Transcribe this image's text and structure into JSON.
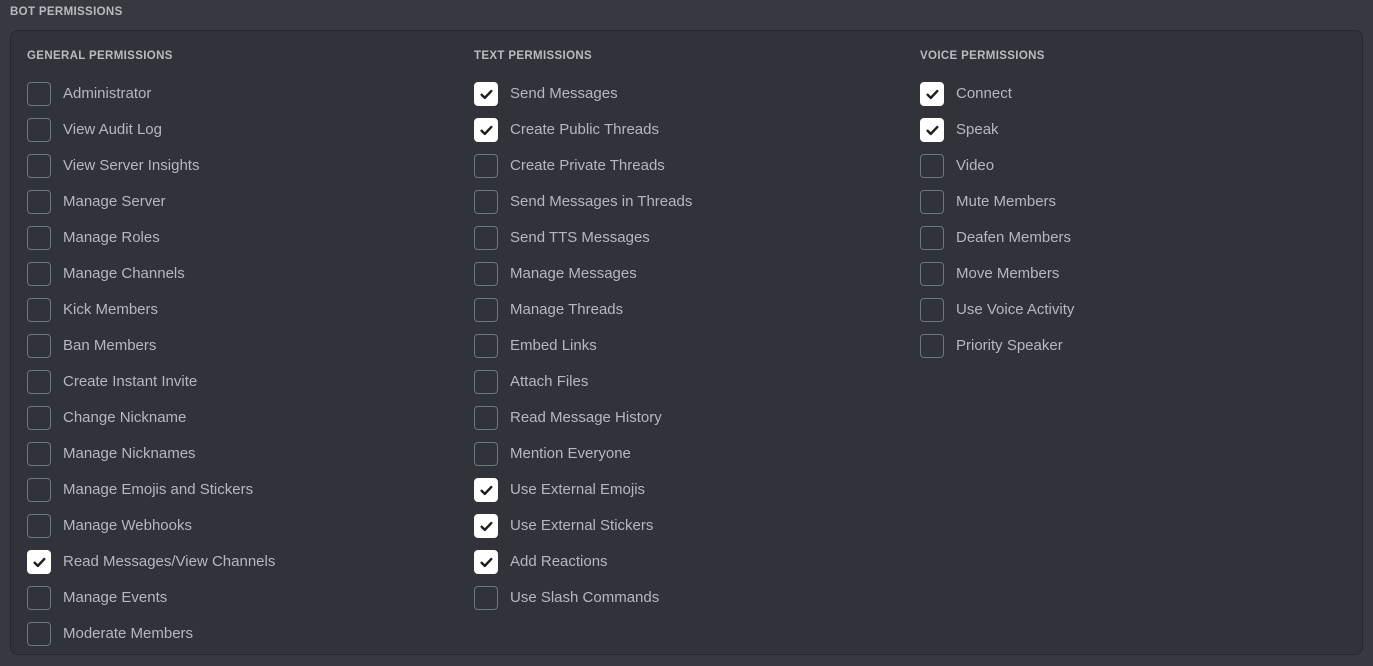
{
  "page": {
    "heading": "BOT PERMISSIONS",
    "background_color": "#36393f",
    "panel_color": "#303339",
    "panel_border_color": "#26282c",
    "label_color": "#b5b8bd",
    "heading_color": "#b9bbbe",
    "checkbox_checked_color": "#ffffff",
    "checkbox_unchecked_border_color": "#72767d",
    "checkmark_color": "#1e1f22"
  },
  "columns": [
    {
      "title": "GENERAL PERMISSIONS",
      "items": [
        {
          "label": "Administrator",
          "checked": false
        },
        {
          "label": "View Audit Log",
          "checked": false
        },
        {
          "label": "View Server Insights",
          "checked": false
        },
        {
          "label": "Manage Server",
          "checked": false
        },
        {
          "label": "Manage Roles",
          "checked": false
        },
        {
          "label": "Manage Channels",
          "checked": false
        },
        {
          "label": "Kick Members",
          "checked": false
        },
        {
          "label": "Ban Members",
          "checked": false
        },
        {
          "label": "Create Instant Invite",
          "checked": false
        },
        {
          "label": "Change Nickname",
          "checked": false
        },
        {
          "label": "Manage Nicknames",
          "checked": false
        },
        {
          "label": "Manage Emojis and Stickers",
          "checked": false
        },
        {
          "label": "Manage Webhooks",
          "checked": false
        },
        {
          "label": "Read Messages/View Channels",
          "checked": true
        },
        {
          "label": "Manage Events",
          "checked": false
        },
        {
          "label": "Moderate Members",
          "checked": false
        }
      ]
    },
    {
      "title": "TEXT PERMISSIONS",
      "items": [
        {
          "label": "Send Messages",
          "checked": true
        },
        {
          "label": "Create Public Threads",
          "checked": true
        },
        {
          "label": "Create Private Threads",
          "checked": false
        },
        {
          "label": "Send Messages in Threads",
          "checked": false
        },
        {
          "label": "Send TTS Messages",
          "checked": false
        },
        {
          "label": "Manage Messages",
          "checked": false
        },
        {
          "label": "Manage Threads",
          "checked": false
        },
        {
          "label": "Embed Links",
          "checked": false
        },
        {
          "label": "Attach Files",
          "checked": false
        },
        {
          "label": "Read Message History",
          "checked": false
        },
        {
          "label": "Mention Everyone",
          "checked": false
        },
        {
          "label": "Use External Emojis",
          "checked": true
        },
        {
          "label": "Use External Stickers",
          "checked": true
        },
        {
          "label": "Add Reactions",
          "checked": true
        },
        {
          "label": "Use Slash Commands",
          "checked": false
        }
      ]
    },
    {
      "title": "VOICE PERMISSIONS",
      "items": [
        {
          "label": "Connect",
          "checked": true
        },
        {
          "label": "Speak",
          "checked": true
        },
        {
          "label": "Video",
          "checked": false
        },
        {
          "label": "Mute Members",
          "checked": false
        },
        {
          "label": "Deafen Members",
          "checked": false
        },
        {
          "label": "Move Members",
          "checked": false
        },
        {
          "label": "Use Voice Activity",
          "checked": false
        },
        {
          "label": "Priority Speaker",
          "checked": false
        }
      ]
    }
  ]
}
